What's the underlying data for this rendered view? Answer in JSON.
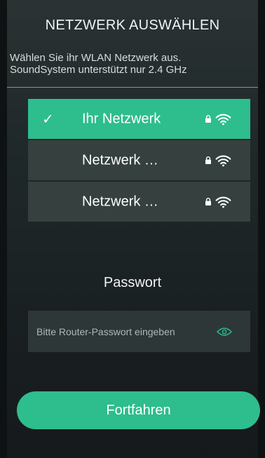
{
  "header": {
    "title": "NETZWERK AUSWÄHLEN"
  },
  "subtitle": {
    "line1": "Wählen Sie ihr WLAN Netzwerk aus.",
    "line2": "SoundSystem unterstützt nur 2.4 GHz"
  },
  "networks": [
    {
      "name": "Ihr Netzwerk",
      "selected": true,
      "check": "✓",
      "secured": true,
      "icon": "wifi-icon"
    },
    {
      "name": "Netzwerk …",
      "selected": false,
      "check": "",
      "secured": true,
      "icon": "wifi-icon"
    },
    {
      "name": "Netzwerk …",
      "selected": false,
      "check": "",
      "secured": true,
      "icon": "wifi-icon"
    }
  ],
  "password": {
    "label": "Passwort",
    "placeholder": "Bitte Router-Passwort eingeben",
    "value": "",
    "toggle_icon": "eye-icon"
  },
  "actions": {
    "continue_label": "Fortfahren"
  },
  "colors": {
    "accent": "#2ebd8d",
    "list_item_bg": "#35403f",
    "field_bg": "#2e3737",
    "text": "#ffffff"
  }
}
